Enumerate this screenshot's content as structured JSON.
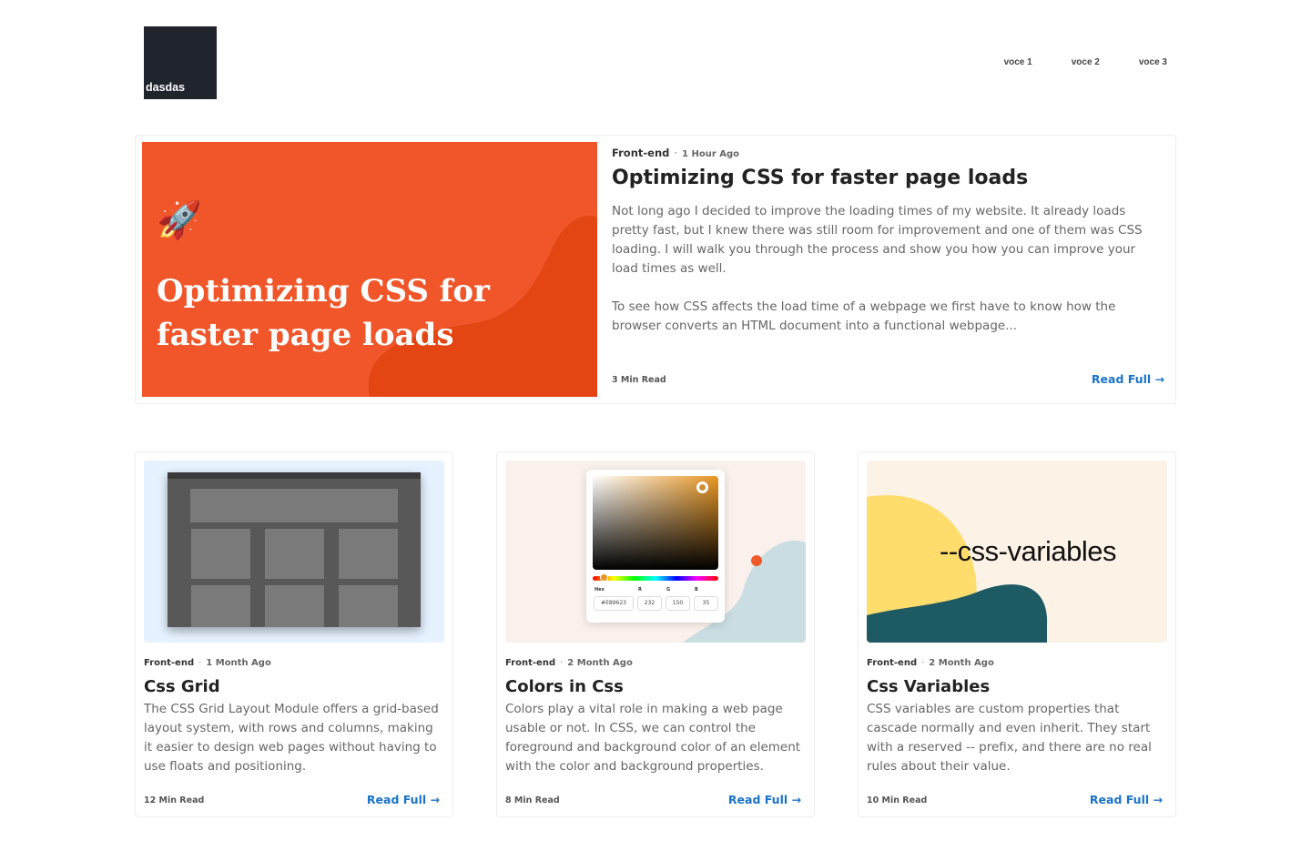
{
  "header": {
    "logo_text": "dasdas",
    "nav": [
      "voce 1",
      "voce 2",
      "voce 3"
    ]
  },
  "featured": {
    "image_title": "Optimizing CSS for faster page loads",
    "image_icon": "rocket-icon",
    "category": "Front-end",
    "ago": "1 Hour Ago",
    "title": "Optimizing CSS for faster page loads",
    "paragraphs": [
      "Not long ago I decided to improve the loading times of my website. It already loads pretty fast, but I knew there was still room for improvement and one of them was CSS loading. I will walk you through the process and show you how you can improve your load times as well.",
      "To see how CSS affects the load time of a webpage we first have to know how the browser converts an HTML document into a functional webpage..."
    ],
    "read_time": "3 Min Read",
    "read_full": "Read Full"
  },
  "cards": [
    {
      "category": "Front-end",
      "ago": "1 Month Ago",
      "title": "Css Grid",
      "description": "The CSS Grid Layout Module offers a grid-based layout system, with rows and columns, making it easier to design web pages without having to use floats and positioning.",
      "read_time": "12 Min Read",
      "read_full": "Read Full"
    },
    {
      "category": "Front-end",
      "ago": "2 Month Ago",
      "title": "Colors in Css",
      "description": "Colors play a vital role in making a web page usable or not. In CSS, we can control the foreground and background color of an element with the color and background properties.",
      "read_time": "8 Min Read",
      "read_full": "Read Full",
      "picker": {
        "labels": [
          "Hex",
          "R",
          "G",
          "B"
        ],
        "values": [
          "#E89623",
          "232",
          "150",
          "35"
        ]
      }
    },
    {
      "category": "Front-end",
      "ago": "2 Month Ago",
      "title": "Css Variables",
      "description": "CSS variables are custom properties that cascade normally and even inherit. They start with a reserved -- prefix, and there are no real rules about their value.",
      "read_time": "10 Min Read",
      "read_full": "Read Full",
      "image_text": "--css-variables"
    }
  ],
  "colors": {
    "accent": "#1a73c8",
    "featured_bg": "#f0562a",
    "logo_bg": "#1f242d"
  }
}
